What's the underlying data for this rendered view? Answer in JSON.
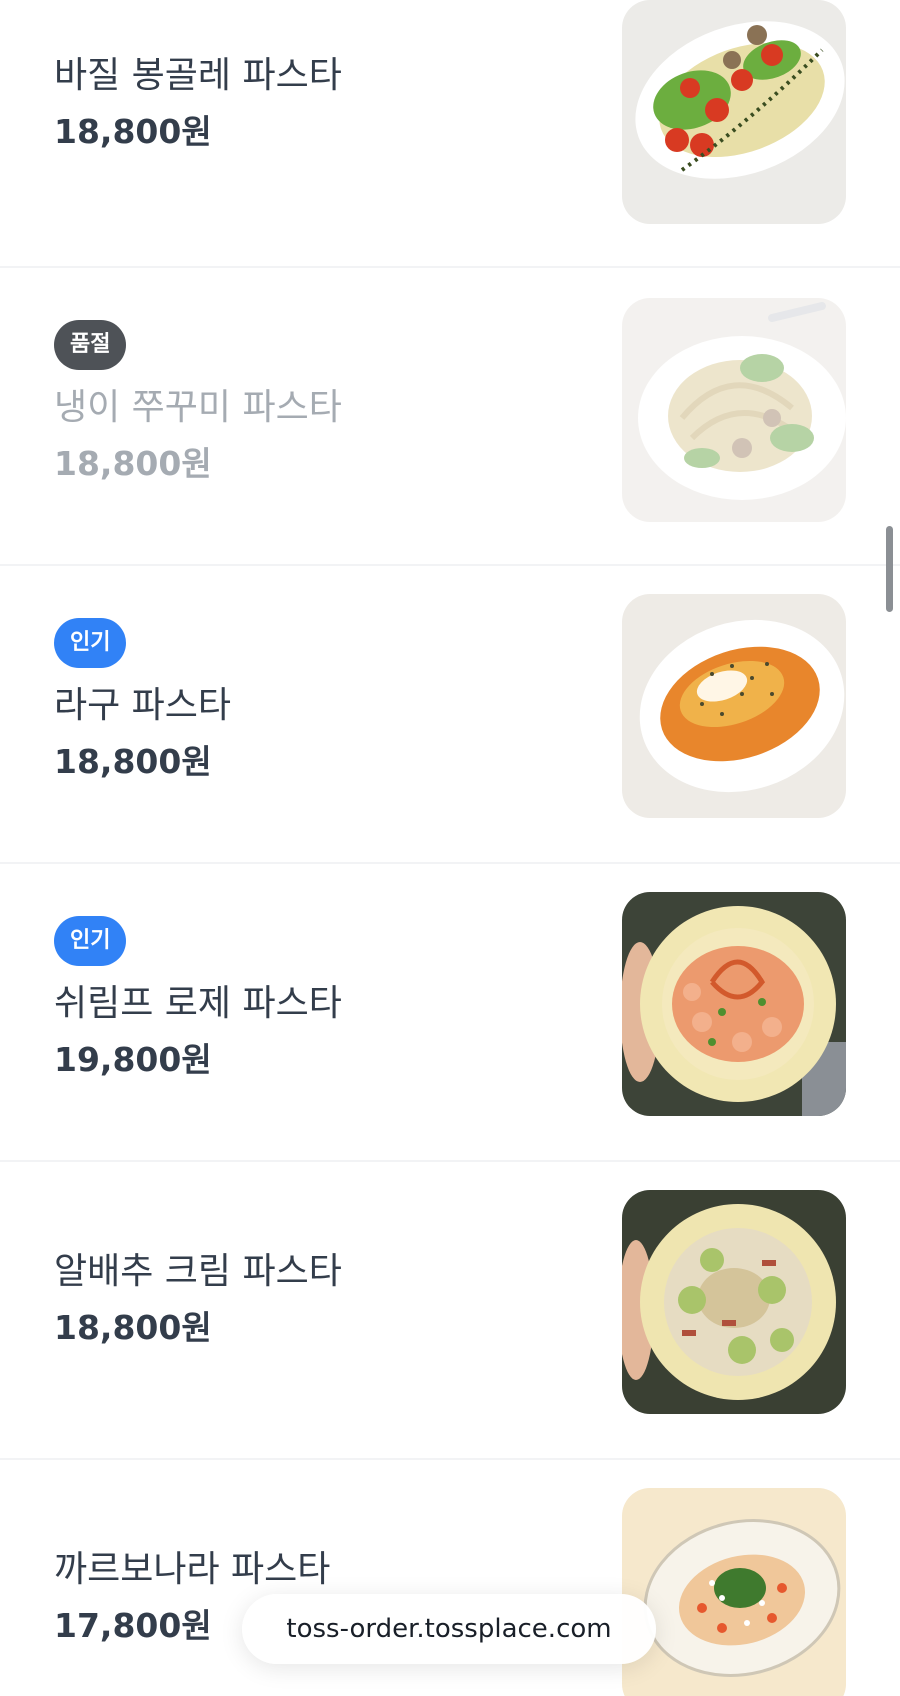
{
  "menu": {
    "items": [
      {
        "name": "바질 봉골레 파스타",
        "price": "18,800원",
        "badge": ""
      },
      {
        "name": "냉이 쭈꾸미 파스타",
        "price": "18,800원",
        "badge": "품절"
      },
      {
        "name": "라구 파스타",
        "price": "18,800원",
        "badge": "인기"
      },
      {
        "name": "쉬림프 로제 파스타",
        "price": "19,800원",
        "badge": "인기"
      },
      {
        "name": "알배추 크림 파스타",
        "price": "18,800원",
        "badge": ""
      },
      {
        "name": "까르보나라 파스타",
        "price": "17,800원",
        "badge": ""
      }
    ]
  },
  "browser": {
    "url": "toss-order.tossplace.com"
  },
  "colors": {
    "popular_badge": "#3182f6",
    "soldout_badge": "#4e5257",
    "text_primary": "#333d4b",
    "text_disabled": "#a5abb2"
  }
}
